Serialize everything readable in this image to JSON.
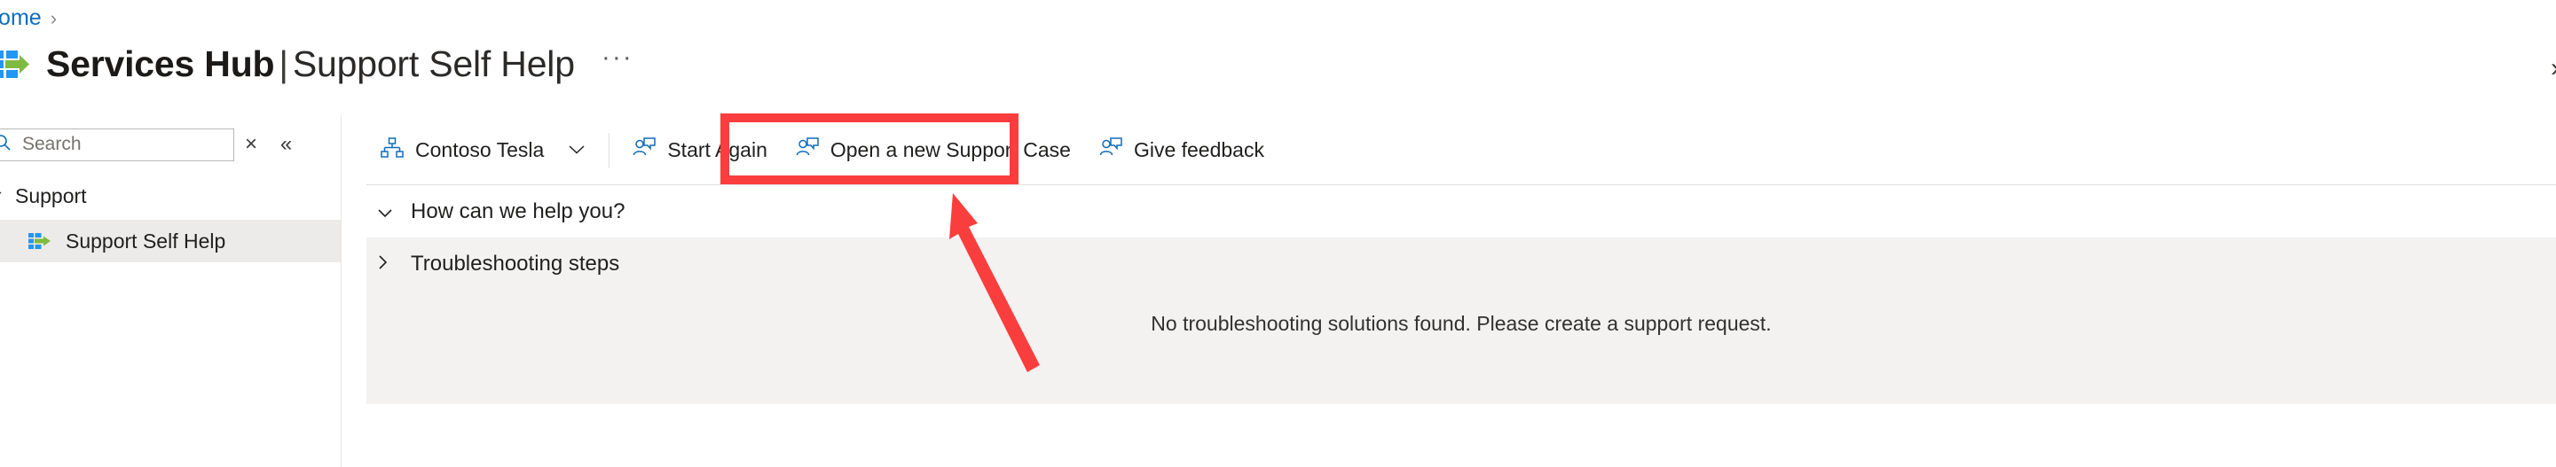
{
  "breadcrumb": {
    "items": [
      {
        "label": "Home"
      }
    ],
    "separator": "›"
  },
  "header": {
    "title_bold": "Services Hub",
    "title_separator": "|",
    "title_light": "Support Self Help",
    "overflow_label": "···",
    "logo_icon": "services-hub-logo-icon",
    "right_expand_icon": "›"
  },
  "search": {
    "placeholder": "Search",
    "value": "",
    "search_icon": "search-icon",
    "clear_label": "×",
    "collapse_label": "«"
  },
  "sidebar": {
    "group": {
      "label": "Support",
      "chevron": "⌄"
    },
    "items": [
      {
        "label": "Support Self Help",
        "icon": "services-hub-mini-logo-icon",
        "selected": true
      }
    ]
  },
  "commandbar": {
    "items": [
      {
        "label": "Contoso Tesla",
        "icon": "org-hierarchy-icon",
        "chevron": "⌄",
        "has_chevron": true
      },
      {
        "label": "Start Again",
        "icon": "user-message-icon",
        "has_chevron": false
      },
      {
        "label": "Open a new Support Case",
        "icon": "user-message-icon",
        "has_chevron": false,
        "highlighted": true
      },
      {
        "label": "Give feedback",
        "icon": "user-message-icon",
        "has_chevron": false
      }
    ]
  },
  "content": {
    "sections": [
      {
        "label": "How can we help you?",
        "expanded": true,
        "chevron": "⌄"
      },
      {
        "label": "Troubleshooting steps",
        "expanded": false,
        "chevron": "›"
      }
    ],
    "empty_message": "No troubleshooting solutions found. Please create a support request."
  },
  "annotations": {
    "highlight_color": "#fa3e3e",
    "arrow_color": "#fa3e3e",
    "highlight_target": "Open a new Support Case"
  },
  "colors": {
    "accent_blue": "#0f6cbd",
    "logo_green": "#7fba42",
    "logo_blue": "#2196f3",
    "selected_bg": "#edebe9",
    "panel_bg": "#f3f2f1"
  }
}
